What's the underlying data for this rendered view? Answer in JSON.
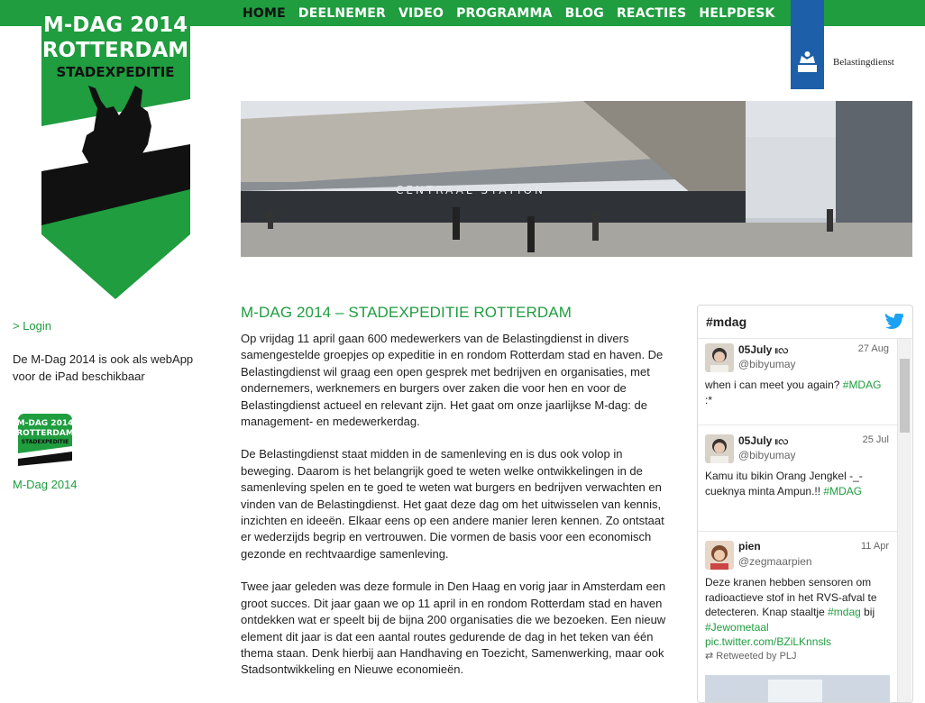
{
  "nav": {
    "items": [
      "HOME",
      "DEELNEMER",
      "VIDEO",
      "PROGRAMMA",
      "BLOG",
      "REACTIES",
      "HELPDESK"
    ],
    "active": "HOME"
  },
  "logo": {
    "line1": "M-DAG 2014",
    "line2": "ROTTERDAM",
    "line3": "STADEXPEDITIE"
  },
  "brand": {
    "name": "Belastingdienst"
  },
  "hero": {
    "sign": "CENTRAAL STATION"
  },
  "sidebar": {
    "login": "> Login",
    "webapp_text": "De M-Dag 2014 is ook als webApp voor de iPad beschikbaar",
    "app_link": "M-Dag 2014"
  },
  "main": {
    "title": "M-DAG 2014 – STADEXPEDITIE ROTTERDAM",
    "paragraphs": [
      "Op vrijdag 11 april gaan 600 medewerkers van de Belastingdienst in divers samengestelde groepjes op expeditie in en rondom Rotterdam stad en haven. De Belastingdienst wil graag een open gesprek met bedrijven en organisaties, met ondernemers, werknemers en burgers over zaken die voor hen en voor de Belastingdienst actueel en relevant zijn. Het gaat om onze jaarlijkse M-dag: de management- en medewerkerdag.",
      "De Belastingdienst staat midden in de samenleving en is dus ook volop in beweging. Daarom is het belangrijk goed te weten welke ontwikkelingen in de samenleving spelen en te goed te weten wat burgers en bedrijven verwachten en vinden van de Belastingdienst. Het gaat deze dag om het uitwisselen van kennis, inzichten en ideeën. Elkaar eens op een andere manier leren kennen. Zo ontstaat er wederzijds begrip en vertrouwen. Die vormen de basis voor een economisch gezonde en rechtvaardige samenleving.",
      "Twee jaar geleden was deze formule in Den Haag en vorig jaar in Amsterdam een groot succes. Dit jaar gaan we op 11 april in en rondom Rotterdam stad en haven ontdekken wat er speelt bij de bijna 200 organisaties die we bezoeken. Een nieuw element dit jaar is dat een aantal routes gedurende de dag in het teken van één thema staan. Denk hierbij aan Handhaving en Toezicht, Samenwerking, maar ook Stadsontwikkeling en Nieuwe economieën."
    ]
  },
  "twitter": {
    "title": "#mdag",
    "tweets": [
      {
        "name": "05July ။လ",
        "handle": "@bibyumay",
        "date": "27 Aug",
        "text": "when i can meet you again? ",
        "tag": "#MDAG",
        "text2": " :*"
      },
      {
        "name": "05July ။လ",
        "handle": "@bibyumay",
        "date": "25 Jul",
        "text": "Kamu itu bikin Orang Jengkel -_- cueknya minta Ampun.!! ",
        "tag": "#MDAG",
        "text2": ""
      },
      {
        "name": "pien",
        "handle": "@zegmaarpien",
        "date": "11 Apr",
        "text": "Deze kranen hebben sensoren om radioactieve stof in het RVS-afval te detecteren. Knap staaltje ",
        "tag": "#mdag",
        "text2": " bij ",
        "tag2": "#Jewometaal",
        "link": "pic.twitter.com/BZiLKnnsls",
        "retweet": "Retweeted by PLJ"
      }
    ]
  },
  "colors": {
    "green": "#1f9d3f",
    "blue": "#1d5fa8"
  }
}
